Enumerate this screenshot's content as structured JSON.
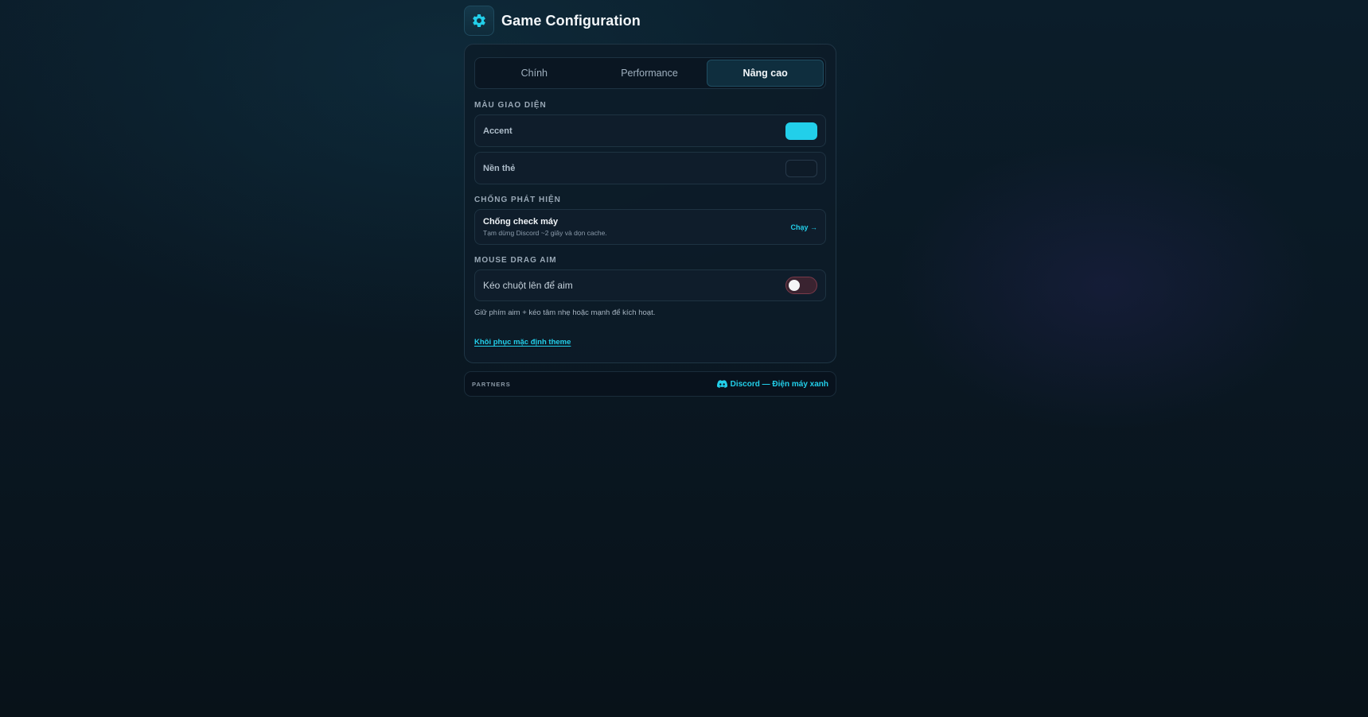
{
  "header": {
    "title": "Game Configuration",
    "icon": "gear-icon"
  },
  "tabs": [
    {
      "label": "Chính",
      "active": false
    },
    {
      "label": "Performance",
      "active": false
    },
    {
      "label": "Nâng cao",
      "active": true
    }
  ],
  "theme_colors": {
    "section_title": "Màu giao diện",
    "accent": {
      "label": "Accent",
      "color": "#22cfea"
    },
    "card_bg": {
      "label": "Nền thẻ",
      "color": "#0e1b28"
    }
  },
  "anti_detect": {
    "section_title": "Chống phát hiện",
    "title": "Chống check máy",
    "subtitle": "Tạm dừng Discord ~2 giây và dọn cache.",
    "action_label": "Chạy →"
  },
  "mouse_drag": {
    "section_title": "Mouse drag aim",
    "toggle_label": "Kéo chuột lên để aim",
    "enabled": false,
    "hint": "Giữ phím aim + kéo tâm nhẹ hoặc mạnh để kích hoạt."
  },
  "reset_link": "Khôi phục mặc định theme",
  "partners": {
    "label": "PARTNERS",
    "link_label": "Discord — Điện máy xanh",
    "icon": "discord-icon"
  },
  "colors": {
    "accent": "#22cfea",
    "toggle_off": "#7a3a4a"
  }
}
